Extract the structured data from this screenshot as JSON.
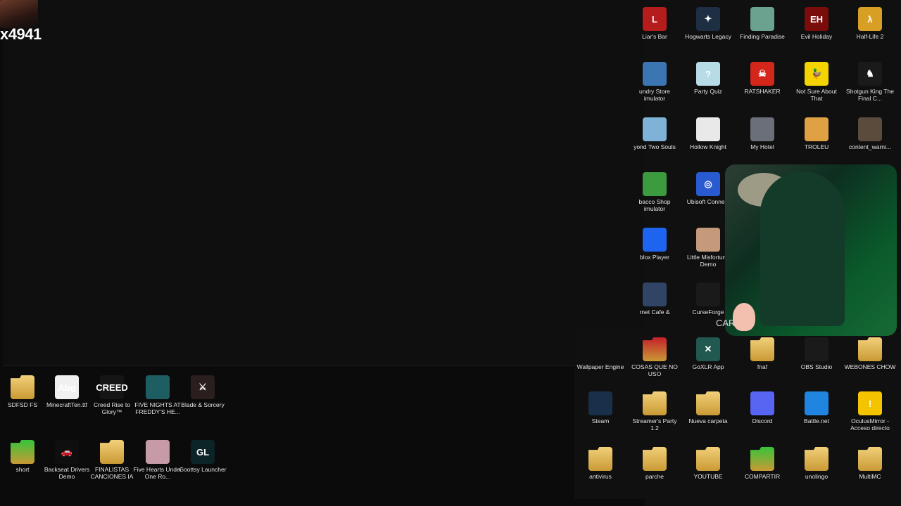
{
  "stream": {
    "viewer_tag": "x4941",
    "overlay_text": "CAR"
  },
  "icons": [
    {
      "id": "liars-bar",
      "label": "Liar's Bar",
      "icon": "liars-bar-icon",
      "color": "#b51d1d",
      "glyph": "L"
    },
    {
      "id": "hogwarts",
      "label": "Hogwarts Legacy",
      "icon": "hogwarts-icon",
      "color": "#1e2f44",
      "glyph": "✦"
    },
    {
      "id": "finding-paradise",
      "label": "Finding Paradise",
      "icon": "finding-paradise-icon",
      "color": "#6aa28f",
      "glyph": ""
    },
    {
      "id": "evil-holiday",
      "label": "Evil Holiday",
      "icon": "evil-holiday-icon",
      "color": "#7a0c0c",
      "glyph": "EH"
    },
    {
      "id": "half-life-2",
      "label": "Half-Life 2",
      "icon": "half-life-icon",
      "color": "#d7a025",
      "glyph": "λ"
    },
    {
      "id": "laundry",
      "label": "undry Store imulator",
      "icon": "laundry-icon",
      "color": "#3b76b3",
      "glyph": ""
    },
    {
      "id": "party-quiz",
      "label": "Party Quiz",
      "icon": "party-quiz-icon",
      "color": "#b8dbe8",
      "glyph": "?"
    },
    {
      "id": "ratshaker",
      "label": "RATSHAKER",
      "icon": "ratshaker-icon",
      "color": "#d5261b",
      "glyph": "☠"
    },
    {
      "id": "not-sure",
      "label": "Not Sure About That",
      "icon": "duck-icon",
      "color": "#f5d300",
      "glyph": "🦆"
    },
    {
      "id": "shotgun-king",
      "label": "Shotgun King The Final C...",
      "icon": "shotgun-king-icon",
      "color": "#1a1a1a",
      "glyph": "♞"
    },
    {
      "id": "beyond-two-souls",
      "label": "yond Two Souls",
      "icon": "beyond-two-souls-icon",
      "color": "#7fb2d7",
      "glyph": ""
    },
    {
      "id": "hollow-knight",
      "label": "Hollow Knight",
      "icon": "hollow-knight-icon",
      "color": "#e9e9e9",
      "glyph": ""
    },
    {
      "id": "my-hotel",
      "label": "My Hotel",
      "icon": "my-hotel-icon",
      "color": "#6b6f7a",
      "glyph": ""
    },
    {
      "id": "troleu",
      "label": "TROLEU",
      "icon": "troleu-icon",
      "color": "#e0a044",
      "glyph": ""
    },
    {
      "id": "content-warning",
      "label": "content_warni...",
      "icon": "content-warning-icon",
      "color": "#5a4b3c",
      "glyph": ""
    },
    {
      "id": "tobacco-shop",
      "label": "bacco Shop imulator",
      "icon": "tobacco-shop-icon",
      "color": "#3c9a3f",
      "glyph": ""
    },
    {
      "id": "ubisoft",
      "label": "Ubisoft Connect",
      "icon": "ubisoft-icon",
      "color": "#2a5ad0",
      "glyph": "◎"
    },
    {
      "id": "roblox",
      "label": "blox Player",
      "icon": "roblox-icon",
      "color": "#1f64f0",
      "glyph": ""
    },
    {
      "id": "little-misfortune",
      "label": "Little Misfortune Demo",
      "icon": "little-misfortune-icon",
      "color": "#c59a7a",
      "glyph": ""
    },
    {
      "id": "internet-cafe",
      "label": "rnet Cafe &",
      "icon": "internet-cafe-icon",
      "color": "#304565",
      "glyph": ""
    },
    {
      "id": "curseforge",
      "label": "CurseForge",
      "icon": "curseforge-icon",
      "color": "#1a1a1a",
      "glyph": ""
    },
    {
      "id": "wallpaper-engine",
      "label": "Wallpaper Engine",
      "icon": "wallpaper-engine-icon",
      "color": "#101010",
      "glyph": ""
    },
    {
      "id": "cosas",
      "label": "COSAS QUE NO USO",
      "icon": "folder-icon",
      "color": "#c4202a",
      "glyph": ""
    },
    {
      "id": "goxlr",
      "label": "GoXLR App",
      "icon": "goxlr-icon",
      "color": "#21584f",
      "glyph": "✕"
    },
    {
      "id": "fnaf",
      "label": "fnaf",
      "icon": "folder-icon",
      "color": "#f2d07a",
      "glyph": ""
    },
    {
      "id": "obs",
      "label": "OBS Studio",
      "icon": "obs-icon",
      "color": "#1a1a1a",
      "glyph": ""
    },
    {
      "id": "webones",
      "label": "WEBONES CHOW",
      "icon": "folder-icon",
      "color": "#f2d07a",
      "glyph": ""
    },
    {
      "id": "steam",
      "label": "Steam",
      "icon": "steam-icon",
      "color": "#1a2f4a",
      "glyph": ""
    },
    {
      "id": "streamers-party",
      "label": "Streamer's Party 1.2",
      "icon": "folder-icon",
      "color": "#f2d07a",
      "glyph": ""
    },
    {
      "id": "nueva-carpeta",
      "label": "Nueva carpeta",
      "icon": "folder-icon",
      "color": "#f2d07a",
      "glyph": ""
    },
    {
      "id": "discord",
      "label": "Discord",
      "icon": "discord-icon",
      "color": "#5865f2",
      "glyph": ""
    },
    {
      "id": "battle-net",
      "label": "Battle.net",
      "icon": "battle-net-icon",
      "color": "#1f85e0",
      "glyph": ""
    },
    {
      "id": "oculus",
      "label": "OculusMirror - Acceso directo",
      "icon": "warning-icon",
      "color": "#f5c400",
      "glyph": "!"
    },
    {
      "id": "antivirus",
      "label": "antivirus",
      "icon": "folder-icon",
      "color": "#f2d07a",
      "glyph": ""
    },
    {
      "id": "parche",
      "label": "parche",
      "icon": "folder-icon",
      "color": "#f2d07a",
      "glyph": ""
    },
    {
      "id": "youtube",
      "label": "YOUTUBE",
      "icon": "folder-icon",
      "color": "#f2d07a",
      "glyph": ""
    },
    {
      "id": "compartir",
      "label": "COMPARTIR",
      "icon": "folder-icon",
      "color": "#35c43a",
      "glyph": ""
    },
    {
      "id": "unolingo",
      "label": "unolingo",
      "icon": "folder-icon",
      "color": "#f2d07a",
      "glyph": ""
    },
    {
      "id": "multimc",
      "label": "MultiMC",
      "icon": "folder-icon",
      "color": "#f2d07a",
      "glyph": ""
    },
    {
      "id": "sdfsd",
      "label": "SDFSD FS",
      "icon": "folder-icon",
      "color": "#f2d07a",
      "glyph": ""
    },
    {
      "id": "minecraftten",
      "label": "MinecraftTen.ttf",
      "icon": "font-file-icon",
      "color": "#f0f0f0",
      "glyph": "Abg"
    },
    {
      "id": "creed",
      "label": "Creed Rise to Glory™",
      "icon": "creed-icon",
      "color": "#151515",
      "glyph": "CREED"
    },
    {
      "id": "fnaf-help",
      "label": "FIVE NIGHTS AT FREDDY'S HE...",
      "icon": "fnaf-help-wanted-icon",
      "color": "#1e5e63",
      "glyph": ""
    },
    {
      "id": "blade-sorcery",
      "label": "Blade & Sorcery",
      "icon": "blade-sorcery-icon",
      "color": "#2a1e1e",
      "glyph": "⚔"
    },
    {
      "id": "short",
      "label": "short",
      "icon": "folder-icon",
      "color": "#35c43a",
      "glyph": ""
    },
    {
      "id": "backseat",
      "label": "Backseat Drivers Demo",
      "icon": "backseat-drivers-icon",
      "color": "#0f0f0f",
      "glyph": "🚗"
    },
    {
      "id": "finalistas",
      "label": "FINALISTAS CANCIONES IA",
      "icon": "folder-icon",
      "color": "#f2d07a",
      "glyph": ""
    },
    {
      "id": "five-hearts",
      "label": "Five Hearts Under One Ro...",
      "icon": "five-hearts-icon",
      "color": "#c69aa6",
      "glyph": ""
    },
    {
      "id": "goottsy",
      "label": "Goottsy Launcher",
      "icon": "goottsy-icon",
      "color": "#0c2328",
      "glyph": "GL"
    }
  ]
}
